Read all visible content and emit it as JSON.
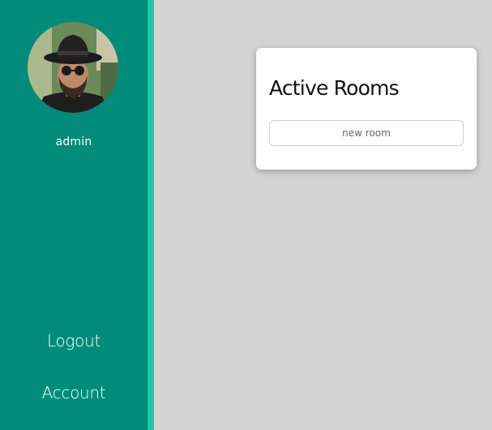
{
  "sidebar": {
    "username": "admin",
    "nav": {
      "logout_label": "Logout",
      "account_label": "Account"
    },
    "colors": {
      "background": "#008b7a",
      "edge": "#1fc4a8"
    }
  },
  "main": {
    "card": {
      "title": "Active Rooms",
      "new_room_label": "new room"
    }
  }
}
